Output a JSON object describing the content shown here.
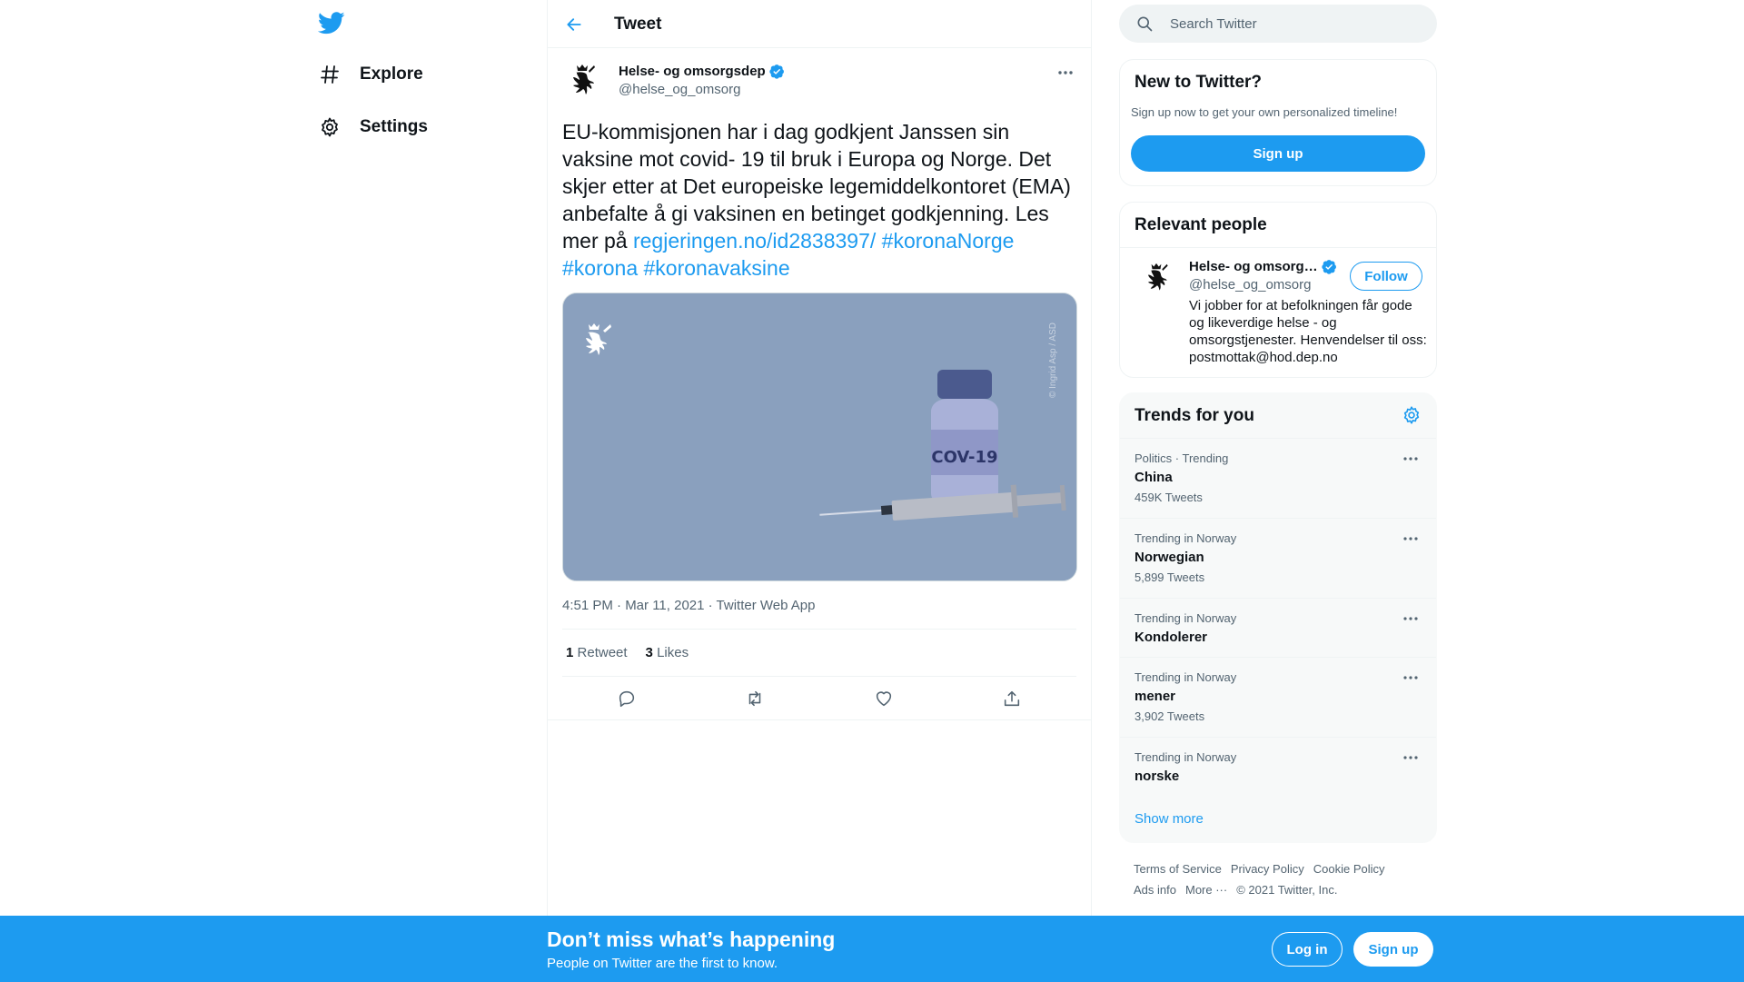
{
  "colors": {
    "accent": "#1d9bf0",
    "text": "#0f1419",
    "muted": "#536471",
    "banner": "#1d9bf0",
    "image_bg": "#8aa0be"
  },
  "nav": {
    "logo_icon": "twitter-bird-icon",
    "items": [
      {
        "label": "Explore",
        "icon": "hashtag-icon"
      },
      {
        "label": "Settings",
        "icon": "gear-icon"
      }
    ]
  },
  "header": {
    "title": "Tweet",
    "back_icon": "arrow-left-icon"
  },
  "tweet": {
    "author_name": "Helse- og omsorgsdep",
    "author_handle": "@helse_og_omsorg",
    "verified": true,
    "text_plain": "EU-kommisjonen har i dag godkjent Janssen sin vaksine mot covid- 19 til bruk i Europa og Norge. Det skjer etter at Det europeiske legemiddelkontoret (EMA) anbefalte å gi vaksinen en betinget godkjenning. Les mer på",
    "link": "regjeringen.no/id2838397/",
    "hashtags": [
      "#koronaNorge",
      "#korona",
      "#koronavaksine"
    ],
    "image": {
      "vial_label": "COV-19",
      "credit": "© Ingrid Asp / ASD"
    },
    "timestamp": "4:51 PM · Mar 11, 2021 · Twitter Web App",
    "retweets_count": "1",
    "retweets_label": "Retweet",
    "likes_count": "3",
    "likes_label": "Likes"
  },
  "search": {
    "placeholder": "Search Twitter"
  },
  "new_to_twitter": {
    "title": "New to Twitter?",
    "subtitle": "Sign up now to get your own personalized timeline!",
    "button": "Sign up"
  },
  "relevant_people": {
    "title": "Relevant people",
    "name": "Helse- og omsorg…",
    "handle": "@helse_og_omsorg",
    "follow": "Follow",
    "bio": "Vi jobber for at befolkningen får gode og likeverdige helse - og omsorgstjenester. Henvendelser til oss: postmottak@hod.dep.no"
  },
  "trends": {
    "title": "Trends for you",
    "items": [
      {
        "meta": "Politics · Trending",
        "name": "China",
        "count": "459K Tweets"
      },
      {
        "meta": "Trending in Norway",
        "name": "Norwegian",
        "count": "5,899 Tweets"
      },
      {
        "meta": "Trending in Norway",
        "name": "Kondolerer",
        "count": ""
      },
      {
        "meta": "Trending in Norway",
        "name": "mener",
        "count": "3,902 Tweets"
      },
      {
        "meta": "Trending in Norway",
        "name": "norske",
        "count": ""
      }
    ],
    "show_more": "Show more"
  },
  "footer": {
    "links": [
      "Terms of Service",
      "Privacy Policy",
      "Cookie Policy",
      "Ads info",
      "More ···"
    ],
    "copyright": "© 2021 Twitter, Inc."
  },
  "banner": {
    "title": "Don’t miss what’s happening",
    "subtitle": "People on Twitter are the first to know.",
    "login": "Log in",
    "signup": "Sign up"
  }
}
